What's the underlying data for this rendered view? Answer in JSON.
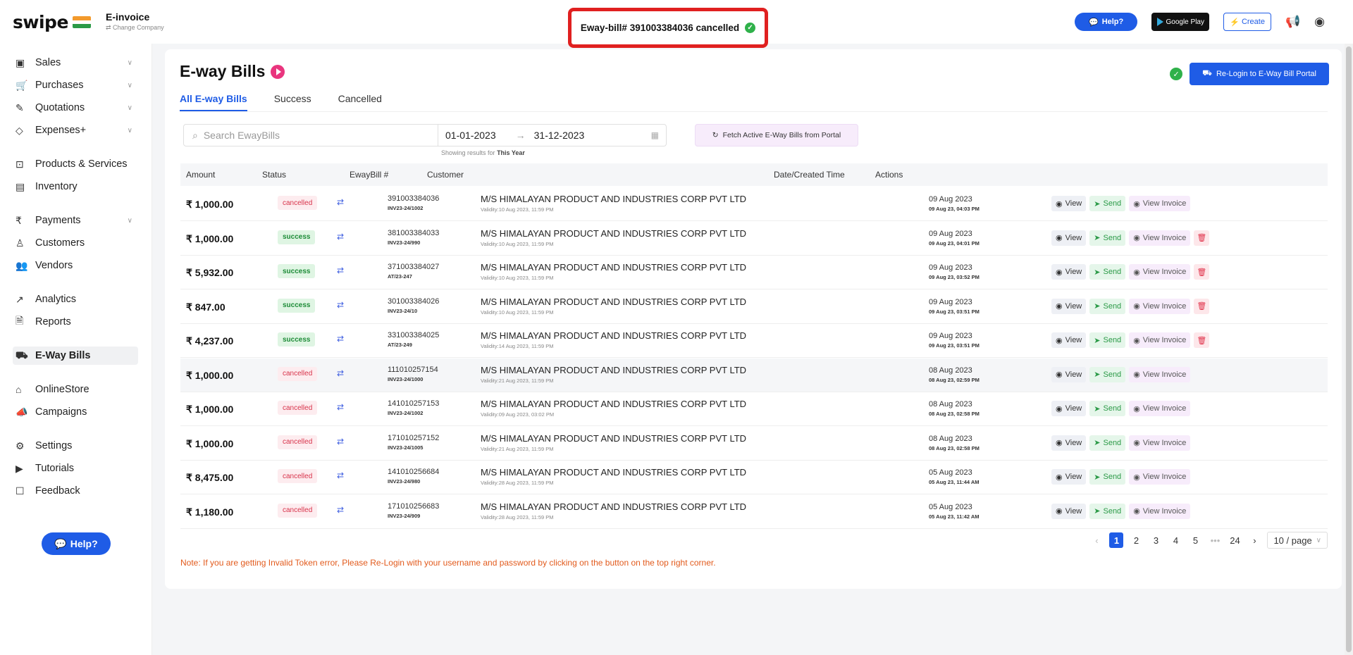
{
  "topbar": {
    "logo": "swipe",
    "company_name": "E-invoice",
    "company_sub": "⇄ Change Company",
    "toast": "Eway-bill# 391003384036 cancelled",
    "help": "Help?",
    "gplay": "Google Play",
    "create": "Create"
  },
  "sidebar": {
    "items": [
      {
        "label": "Sales",
        "icon": "sales-icon"
      },
      {
        "label": "Purchases",
        "icon": "cart-icon"
      },
      {
        "label": "Quotations",
        "icon": "pen-icon"
      },
      {
        "label": "Expenses+",
        "icon": "tag-icon"
      },
      {
        "label": "Products & Services",
        "icon": "box-icon"
      },
      {
        "label": "Inventory",
        "icon": "warehouse-icon"
      },
      {
        "label": "Payments",
        "icon": "rupee-icon"
      },
      {
        "label": "Customers",
        "icon": "user-icon"
      },
      {
        "label": "Vendors",
        "icon": "users-icon"
      },
      {
        "label": "Analytics",
        "icon": "chart-icon"
      },
      {
        "label": "Reports",
        "icon": "report-icon"
      },
      {
        "label": "E-Way Bills",
        "icon": "truck-icon"
      },
      {
        "label": "OnlineStore",
        "icon": "store-icon"
      },
      {
        "label": "Campaigns",
        "icon": "megaphone-icon"
      },
      {
        "label": "Settings",
        "icon": "gear-icon"
      },
      {
        "label": "Tutorials",
        "icon": "youtube-icon"
      },
      {
        "label": "Feedback",
        "icon": "feedback-icon"
      }
    ],
    "help": "Help?"
  },
  "main": {
    "title": "E-way Bills",
    "tabs": [
      "All E-way Bills",
      "Success",
      "Cancelled"
    ],
    "relogin": "Re-Login to E-Way Bill Portal",
    "search_placeholder": "Search EwayBills",
    "date_from": "01-01-2023",
    "date_to": "31-12-2023",
    "showing_prefix": "Showing results for",
    "showing_period": "This Year",
    "fetch": "Fetch Active E-Way Bills from Portal",
    "columns": [
      "Amount",
      "Status",
      "EwayBill #",
      "Customer",
      "Date/Created Time",
      "Actions"
    ],
    "rows": [
      {
        "amount": "₹ 1,000.00",
        "status": "cancelled",
        "ewb": "391003384036",
        "inv": "INV23-24/1002",
        "customer": "M/S HIMALAYAN PRODUCT AND INDUSTRIES CORP PVT LTD",
        "validity": "Validity:10 Aug 2023, 11:59 PM",
        "date": "09 Aug 2023",
        "time": "09 Aug 23, 04:03 PM",
        "del": false
      },
      {
        "amount": "₹ 1,000.00",
        "status": "success",
        "ewb": "381003384033",
        "inv": "INV23-24/990",
        "customer": "M/S HIMALAYAN PRODUCT AND INDUSTRIES CORP PVT LTD",
        "validity": "Validity:10 Aug 2023, 11:59 PM",
        "date": "09 Aug 2023",
        "time": "09 Aug 23, 04:01 PM",
        "del": true
      },
      {
        "amount": "₹ 5,932.00",
        "status": "success",
        "ewb": "371003384027",
        "inv": "AT/23-247",
        "customer": "M/S HIMALAYAN PRODUCT AND INDUSTRIES CORP PVT LTD",
        "validity": "Validity:10 Aug 2023, 11:59 PM",
        "date": "09 Aug 2023",
        "time": "09 Aug 23, 03:52 PM",
        "del": true
      },
      {
        "amount": "₹ 847.00",
        "status": "success",
        "ewb": "301003384026",
        "inv": "INV23-24/10",
        "customer": "M/S HIMALAYAN PRODUCT AND INDUSTRIES CORP PVT LTD",
        "validity": "Validity:10 Aug 2023, 11:59 PM",
        "date": "09 Aug 2023",
        "time": "09 Aug 23, 03:51 PM",
        "del": true
      },
      {
        "amount": "₹ 4,237.00",
        "status": "success",
        "ewb": "331003384025",
        "inv": "AT/23-249",
        "customer": "M/S HIMALAYAN PRODUCT AND INDUSTRIES CORP PVT LTD",
        "validity": "Validity:14 Aug 2023, 11:59 PM",
        "date": "09 Aug 2023",
        "time": "09 Aug 23, 03:51 PM",
        "del": true
      },
      {
        "amount": "₹ 1,000.00",
        "status": "cancelled",
        "ewb": "111010257154",
        "inv": "INV23-24/1000",
        "customer": "M/S HIMALAYAN PRODUCT AND INDUSTRIES CORP PVT LTD",
        "validity": "Validity:21 Aug 2023, 11:59 PM",
        "date": "08 Aug 2023",
        "time": "08 Aug 23, 02:59 PM",
        "del": false
      },
      {
        "amount": "₹ 1,000.00",
        "status": "cancelled",
        "ewb": "141010257153",
        "inv": "INV23-24/1002",
        "customer": "M/S HIMALAYAN PRODUCT AND INDUSTRIES CORP PVT LTD",
        "validity": "Validity:09 Aug 2023, 03:02 PM",
        "date": "08 Aug 2023",
        "time": "08 Aug 23, 02:58 PM",
        "del": false
      },
      {
        "amount": "₹ 1,000.00",
        "status": "cancelled",
        "ewb": "171010257152",
        "inv": "INV23-24/1005",
        "customer": "M/S HIMALAYAN PRODUCT AND INDUSTRIES CORP PVT LTD",
        "validity": "Validity:21 Aug 2023, 11:59 PM",
        "date": "08 Aug 2023",
        "time": "08 Aug 23, 02:58 PM",
        "del": false
      },
      {
        "amount": "₹ 8,475.00",
        "status": "cancelled",
        "ewb": "141010256684",
        "inv": "INV23-24/980",
        "customer": "M/S HIMALAYAN PRODUCT AND INDUSTRIES CORP PVT LTD",
        "validity": "Validity:28 Aug 2023, 11:59 PM",
        "date": "05 Aug 2023",
        "time": "05 Aug 23, 11:44 AM",
        "del": false
      },
      {
        "amount": "₹ 1,180.00",
        "status": "cancelled",
        "ewb": "171010256683",
        "inv": "INV23-24/909",
        "customer": "M/S HIMALAYAN PRODUCT AND INDUSTRIES CORP PVT LTD",
        "validity": "Validity:28 Aug 2023, 11:59 PM",
        "date": "05 Aug 2023",
        "time": "05 Aug 23, 11:42 AM",
        "del": false
      }
    ],
    "actions": {
      "view": "View",
      "send": "Send",
      "view_invoice": "View Invoice"
    },
    "pagination": {
      "pages": [
        "1",
        "2",
        "3",
        "4",
        "5",
        "•••",
        "24"
      ],
      "current": "1",
      "page_size": "10 / page"
    },
    "note": "Note: If you are getting Invalid Token error, Please Re-Login with your username and password by clicking on the button on the top right corner."
  },
  "colors": {
    "accent": "#1f5ce6",
    "success": "#2fb14a",
    "danger": "#e0324a",
    "highlight_border": "#e02020"
  }
}
